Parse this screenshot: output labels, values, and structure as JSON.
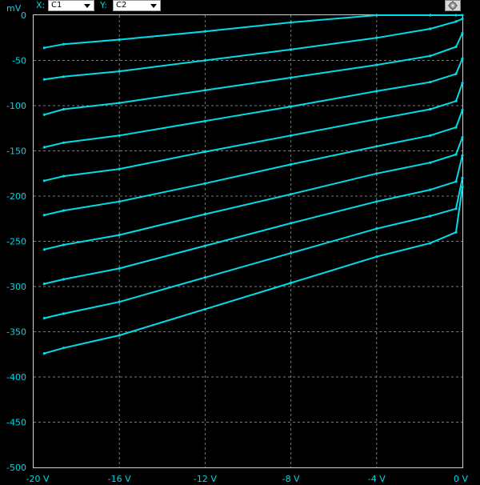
{
  "toolbar": {
    "x_label": "X:",
    "x_channel": "C1",
    "y_label": "Y:",
    "y_channel": "C2",
    "settings_icon": "gear-icon"
  },
  "colors": {
    "background": "#000000",
    "trace": "#00dce8",
    "grid": "#7a7a7a",
    "frame": "#cfcfcf",
    "text": "#00d7e6"
  },
  "chart_data": {
    "type": "scatter",
    "title": "",
    "xlabel": "",
    "ylabel": "mV",
    "xlim": [
      -20,
      0
    ],
    "ylim": [
      -500,
      0
    ],
    "x_ticks": [
      {
        "value": -20,
        "label": "-20 V"
      },
      {
        "value": -16,
        "label": "-16 V"
      },
      {
        "value": -12,
        "label": "-12 V"
      },
      {
        "value": -8,
        "label": "-8 V"
      },
      {
        "value": -4,
        "label": "-4 V"
      },
      {
        "value": 0,
        "label": "0 V"
      }
    ],
    "y_ticks": [
      {
        "value": 0,
        "label": "0"
      },
      {
        "value": -50,
        "label": "-50"
      },
      {
        "value": -100,
        "label": "-100"
      },
      {
        "value": -150,
        "label": "-150"
      },
      {
        "value": -200,
        "label": "-200"
      },
      {
        "value": -250,
        "label": "-250"
      },
      {
        "value": -300,
        "label": "-300"
      },
      {
        "value": -350,
        "label": "-350"
      },
      {
        "value": -400,
        "label": "-400"
      },
      {
        "value": -450,
        "label": "-450"
      },
      {
        "value": -500,
        "label": "-500"
      }
    ],
    "grid": true,
    "series": [
      {
        "x": [
          -19.5,
          -18.6,
          -16,
          -12,
          -8,
          -4,
          -1.5,
          -0.3,
          0
        ],
        "y": [
          -36,
          -32,
          -27,
          -18,
          -8,
          0,
          0,
          0,
          0
        ]
      },
      {
        "x": [
          -19.5,
          -18.6,
          -16,
          -12,
          -8,
          -4,
          -1.5,
          -0.3,
          0
        ],
        "y": [
          -71,
          -68,
          -62,
          -50,
          -38,
          -25,
          -15,
          -7,
          -4
        ]
      },
      {
        "x": [
          -19.5,
          -18.6,
          -16,
          -12,
          -8,
          -4,
          -1.5,
          -0.3,
          0
        ],
        "y": [
          -110,
          -104,
          -97,
          -83,
          -69,
          -55,
          -45,
          -35,
          -20
        ]
      },
      {
        "x": [
          -19.5,
          -18.6,
          -16,
          -12,
          -8,
          -4,
          -1.5,
          -0.3,
          0
        ],
        "y": [
          -146,
          -141,
          -133,
          -117,
          -101,
          -84,
          -74,
          -65,
          -48
        ]
      },
      {
        "x": [
          -19.5,
          -18.6,
          -16,
          -12,
          -8,
          -4,
          -1.5,
          -0.3,
          0
        ],
        "y": [
          -183,
          -178,
          -170,
          -151,
          -133,
          -115,
          -104,
          -95,
          -75
        ]
      },
      {
        "x": [
          -19.5,
          -18.6,
          -16,
          -12,
          -8,
          -4,
          -1.5,
          -0.3,
          0
        ],
        "y": [
          -221,
          -216,
          -206,
          -186,
          -165,
          -145,
          -133,
          -124,
          -105
        ]
      },
      {
        "x": [
          -19.5,
          -18.6,
          -16,
          -12,
          -8,
          -4,
          -1.5,
          -0.3,
          0
        ],
        "y": [
          -259,
          -254,
          -243,
          -220,
          -198,
          -175,
          -163,
          -154,
          -135
        ]
      },
      {
        "x": [
          -19.5,
          -18.6,
          -16,
          -12,
          -8,
          -4,
          -1.5,
          -0.3,
          0
        ],
        "y": [
          -297,
          -292,
          -280,
          -255,
          -230,
          -206,
          -193,
          -184,
          -155
        ]
      },
      {
        "x": [
          -19.5,
          -18.6,
          -16,
          -12,
          -8,
          -4,
          -1.5,
          -0.3,
          0
        ],
        "y": [
          -335,
          -330,
          -317,
          -290,
          -263,
          -236,
          -222,
          -214,
          -180
        ]
      },
      {
        "x": [
          -19.5,
          -18.6,
          -16,
          -12,
          -8,
          -4,
          -1.5,
          -0.3,
          0
        ],
        "y": [
          -374,
          -368,
          -354,
          -325,
          -296,
          -267,
          -252,
          -240,
          -190
        ]
      }
    ]
  }
}
